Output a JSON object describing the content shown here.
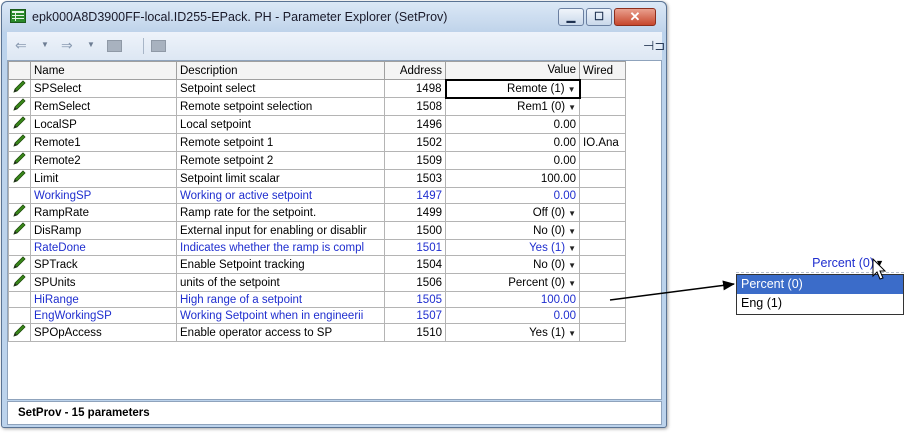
{
  "window": {
    "title": "epk000A8D3900FF-local.ID255-EPack. PH - Parameter Explorer (SetProv)"
  },
  "toolbar": {
    "back_icon": "arrow-left-icon",
    "forward_icon": "arrow-right-icon",
    "pin_icon": "pin-icon"
  },
  "table": {
    "headers": {
      "name": "Name",
      "description": "Description",
      "address": "Address",
      "value": "Value",
      "wired": "Wired"
    },
    "rows": [
      {
        "name": "SPSelect",
        "description": "Setpoint select",
        "address": "1498",
        "value": "Remote (1)",
        "wired": "",
        "editable": true,
        "dropdown": true
      },
      {
        "name": "RemSelect",
        "description": "Remote setpoint selection",
        "address": "1508",
        "value": "Rem1 (0)",
        "wired": "",
        "editable": true,
        "dropdown": true
      },
      {
        "name": "LocalSP",
        "description": "Local setpoint",
        "address": "1496",
        "value": "0.00",
        "wired": "",
        "editable": true,
        "dropdown": false
      },
      {
        "name": "Remote1",
        "description": "Remote setpoint 1",
        "address": "1502",
        "value": "0.00",
        "wired": "IO.Ana",
        "editable": true,
        "dropdown": false
      },
      {
        "name": "Remote2",
        "description": "Remote setpoint 2",
        "address": "1509",
        "value": "0.00",
        "wired": "",
        "editable": true,
        "dropdown": false
      },
      {
        "name": "Limit",
        "description": "Setpoint limit scalar",
        "address": "1503",
        "value": "100.00",
        "wired": "",
        "editable": true,
        "dropdown": false
      },
      {
        "name": "WorkingSP",
        "description": "Working or active setpoint",
        "address": "1497",
        "value": "0.00",
        "wired": "",
        "editable": false,
        "dropdown": false
      },
      {
        "name": "RampRate",
        "description": "Ramp rate for the setpoint.",
        "address": "1499",
        "value": "Off (0)",
        "wired": "",
        "editable": true,
        "dropdown": true
      },
      {
        "name": "DisRamp",
        "description": "External input for enabling or disablir",
        "address": "1500",
        "value": "No (0)",
        "wired": "",
        "editable": true,
        "dropdown": true
      },
      {
        "name": "RateDone",
        "description": "Indicates whether the ramp is compl",
        "address": "1501",
        "value": "Yes (1)",
        "wired": "",
        "editable": false,
        "dropdown": true
      },
      {
        "name": "SPTrack",
        "description": "Enable Setpoint tracking",
        "address": "1504",
        "value": "No (0)",
        "wired": "",
        "editable": true,
        "dropdown": true
      },
      {
        "name": "SPUnits",
        "description": "units of the setpoint",
        "address": "1506",
        "value": "Percent (0)",
        "wired": "",
        "editable": true,
        "dropdown": true
      },
      {
        "name": "HiRange",
        "description": "High range of a setpoint",
        "address": "1505",
        "value": "100.00",
        "wired": "",
        "editable": false,
        "dropdown": false
      },
      {
        "name": "EngWorkingSP",
        "description": "Working Setpoint when in engineerii",
        "address": "1507",
        "value": "0.00",
        "wired": "",
        "editable": false,
        "dropdown": false
      },
      {
        "name": "SPOpAccess",
        "description": "Enable operator access to SP",
        "address": "1510",
        "value": "Yes (1)",
        "wired": "",
        "editable": true,
        "dropdown": true
      }
    ]
  },
  "status": {
    "text": "SetProv  -  15 parameters"
  },
  "popout": {
    "current_value": "Percent (0)",
    "options": [
      {
        "label": "Percent (0)",
        "selected": true
      },
      {
        "label": "Eng (1)",
        "selected": false
      }
    ]
  },
  "colors": {
    "read_only_text": "#1f2ecf",
    "selected_option": "#3b6cc9",
    "edit_icon": "#3a8a1a"
  }
}
